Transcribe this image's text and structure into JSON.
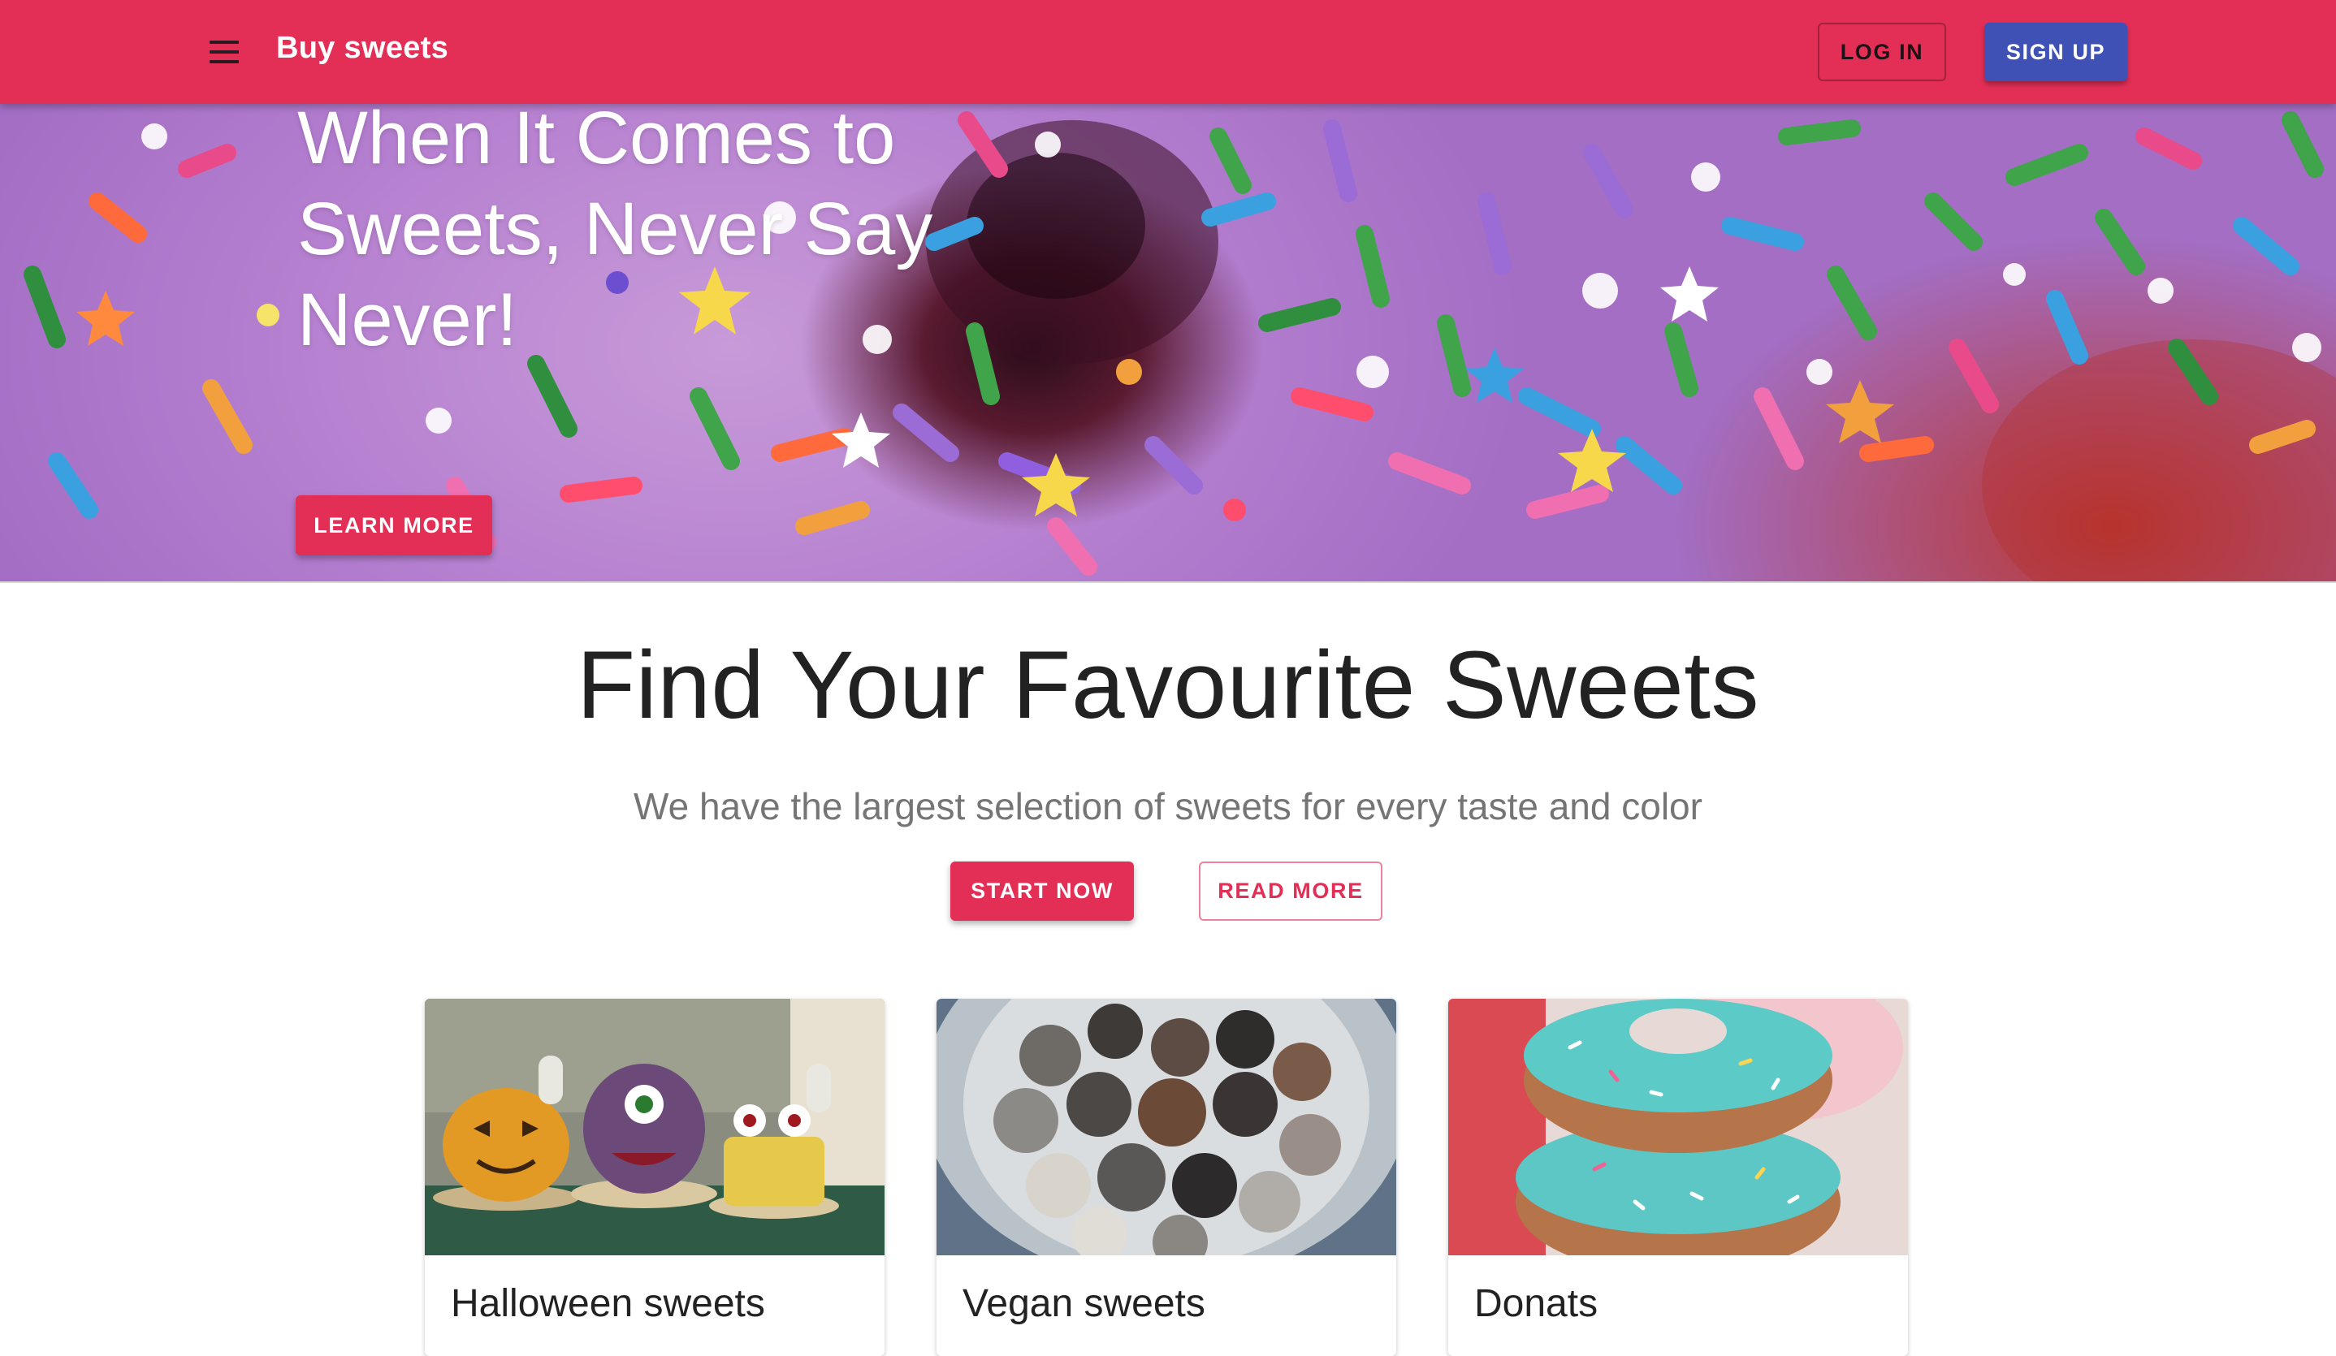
{
  "appbar": {
    "brand": "Buy sweets",
    "login_label": "LOG IN",
    "signup_label": "SIGN UP",
    "menu_icon": "menu-icon",
    "color": "#e32e56"
  },
  "hero": {
    "title": "When It Comes to Sweets, Never Say Never!",
    "learn_label": "LEARN MORE"
  },
  "main": {
    "title": "Find Your Favourite Sweets",
    "subtitle": "We have the largest selection of sweets for every taste and color",
    "start_label": "START NOW",
    "read_label": "READ MORE"
  },
  "cards": [
    {
      "title": "Halloween sweets"
    },
    {
      "title": "Vegan sweets"
    },
    {
      "title": "Donats"
    }
  ],
  "colors": {
    "primary": "#e32e56",
    "secondary": "#3f51b5"
  }
}
